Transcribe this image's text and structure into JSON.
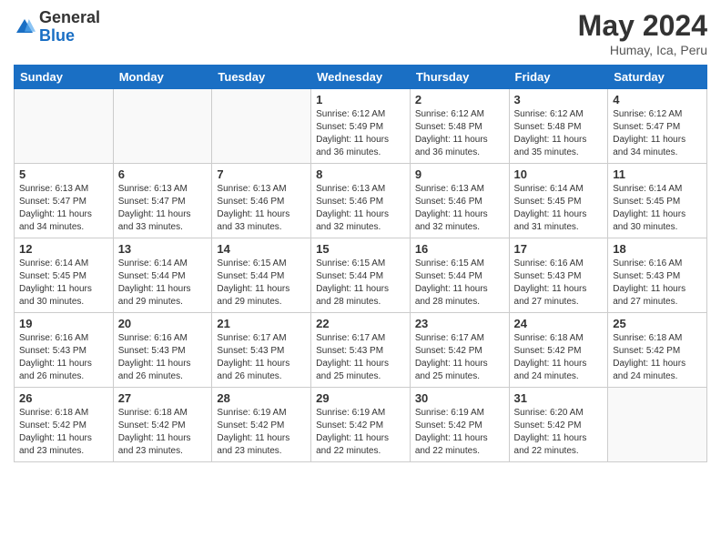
{
  "logo": {
    "general": "General",
    "blue": "Blue"
  },
  "title": "May 2024",
  "location": "Humay, Ica, Peru",
  "days_of_week": [
    "Sunday",
    "Monday",
    "Tuesday",
    "Wednesday",
    "Thursday",
    "Friday",
    "Saturday"
  ],
  "weeks": [
    [
      {
        "day": "",
        "info": ""
      },
      {
        "day": "",
        "info": ""
      },
      {
        "day": "",
        "info": ""
      },
      {
        "day": "1",
        "info": "Sunrise: 6:12 AM\nSunset: 5:49 PM\nDaylight: 11 hours and 36 minutes."
      },
      {
        "day": "2",
        "info": "Sunrise: 6:12 AM\nSunset: 5:48 PM\nDaylight: 11 hours and 36 minutes."
      },
      {
        "day": "3",
        "info": "Sunrise: 6:12 AM\nSunset: 5:48 PM\nDaylight: 11 hours and 35 minutes."
      },
      {
        "day": "4",
        "info": "Sunrise: 6:12 AM\nSunset: 5:47 PM\nDaylight: 11 hours and 34 minutes."
      }
    ],
    [
      {
        "day": "5",
        "info": "Sunrise: 6:13 AM\nSunset: 5:47 PM\nDaylight: 11 hours and 34 minutes."
      },
      {
        "day": "6",
        "info": "Sunrise: 6:13 AM\nSunset: 5:47 PM\nDaylight: 11 hours and 33 minutes."
      },
      {
        "day": "7",
        "info": "Sunrise: 6:13 AM\nSunset: 5:46 PM\nDaylight: 11 hours and 33 minutes."
      },
      {
        "day": "8",
        "info": "Sunrise: 6:13 AM\nSunset: 5:46 PM\nDaylight: 11 hours and 32 minutes."
      },
      {
        "day": "9",
        "info": "Sunrise: 6:13 AM\nSunset: 5:46 PM\nDaylight: 11 hours and 32 minutes."
      },
      {
        "day": "10",
        "info": "Sunrise: 6:14 AM\nSunset: 5:45 PM\nDaylight: 11 hours and 31 minutes."
      },
      {
        "day": "11",
        "info": "Sunrise: 6:14 AM\nSunset: 5:45 PM\nDaylight: 11 hours and 30 minutes."
      }
    ],
    [
      {
        "day": "12",
        "info": "Sunrise: 6:14 AM\nSunset: 5:45 PM\nDaylight: 11 hours and 30 minutes."
      },
      {
        "day": "13",
        "info": "Sunrise: 6:14 AM\nSunset: 5:44 PM\nDaylight: 11 hours and 29 minutes."
      },
      {
        "day": "14",
        "info": "Sunrise: 6:15 AM\nSunset: 5:44 PM\nDaylight: 11 hours and 29 minutes."
      },
      {
        "day": "15",
        "info": "Sunrise: 6:15 AM\nSunset: 5:44 PM\nDaylight: 11 hours and 28 minutes."
      },
      {
        "day": "16",
        "info": "Sunrise: 6:15 AM\nSunset: 5:44 PM\nDaylight: 11 hours and 28 minutes."
      },
      {
        "day": "17",
        "info": "Sunrise: 6:16 AM\nSunset: 5:43 PM\nDaylight: 11 hours and 27 minutes."
      },
      {
        "day": "18",
        "info": "Sunrise: 6:16 AM\nSunset: 5:43 PM\nDaylight: 11 hours and 27 minutes."
      }
    ],
    [
      {
        "day": "19",
        "info": "Sunrise: 6:16 AM\nSunset: 5:43 PM\nDaylight: 11 hours and 26 minutes."
      },
      {
        "day": "20",
        "info": "Sunrise: 6:16 AM\nSunset: 5:43 PM\nDaylight: 11 hours and 26 minutes."
      },
      {
        "day": "21",
        "info": "Sunrise: 6:17 AM\nSunset: 5:43 PM\nDaylight: 11 hours and 26 minutes."
      },
      {
        "day": "22",
        "info": "Sunrise: 6:17 AM\nSunset: 5:43 PM\nDaylight: 11 hours and 25 minutes."
      },
      {
        "day": "23",
        "info": "Sunrise: 6:17 AM\nSunset: 5:42 PM\nDaylight: 11 hours and 25 minutes."
      },
      {
        "day": "24",
        "info": "Sunrise: 6:18 AM\nSunset: 5:42 PM\nDaylight: 11 hours and 24 minutes."
      },
      {
        "day": "25",
        "info": "Sunrise: 6:18 AM\nSunset: 5:42 PM\nDaylight: 11 hours and 24 minutes."
      }
    ],
    [
      {
        "day": "26",
        "info": "Sunrise: 6:18 AM\nSunset: 5:42 PM\nDaylight: 11 hours and 23 minutes."
      },
      {
        "day": "27",
        "info": "Sunrise: 6:18 AM\nSunset: 5:42 PM\nDaylight: 11 hours and 23 minutes."
      },
      {
        "day": "28",
        "info": "Sunrise: 6:19 AM\nSunset: 5:42 PM\nDaylight: 11 hours and 23 minutes."
      },
      {
        "day": "29",
        "info": "Sunrise: 6:19 AM\nSunset: 5:42 PM\nDaylight: 11 hours and 22 minutes."
      },
      {
        "day": "30",
        "info": "Sunrise: 6:19 AM\nSunset: 5:42 PM\nDaylight: 11 hours and 22 minutes."
      },
      {
        "day": "31",
        "info": "Sunrise: 6:20 AM\nSunset: 5:42 PM\nDaylight: 11 hours and 22 minutes."
      },
      {
        "day": "",
        "info": ""
      }
    ]
  ]
}
